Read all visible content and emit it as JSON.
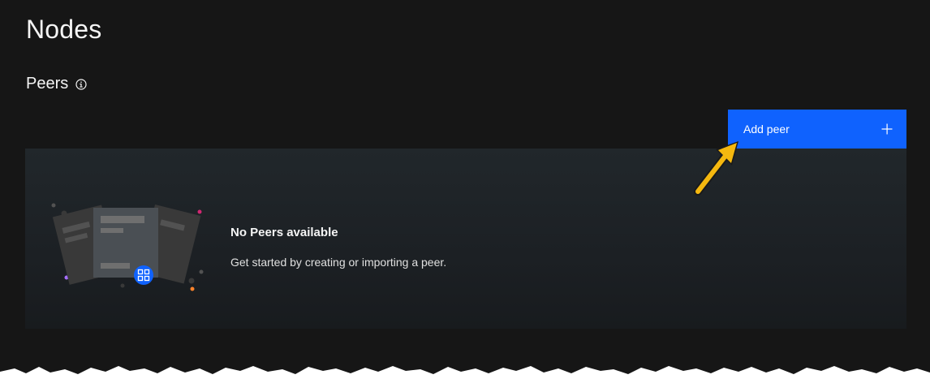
{
  "page": {
    "title": "Nodes"
  },
  "peers_section": {
    "heading": "Peers",
    "info_icon": "info-icon"
  },
  "toolbar": {
    "add_peer_label": "Add peer",
    "add_peer_icon": "plus-icon",
    "accent_color": "#0f62fe"
  },
  "empty_state": {
    "title": "No Peers available",
    "description": "Get started by creating or importing a peer.",
    "illustration": "documents-illustration"
  },
  "annotation": {
    "type": "arrow",
    "color": "#f5b80f"
  }
}
